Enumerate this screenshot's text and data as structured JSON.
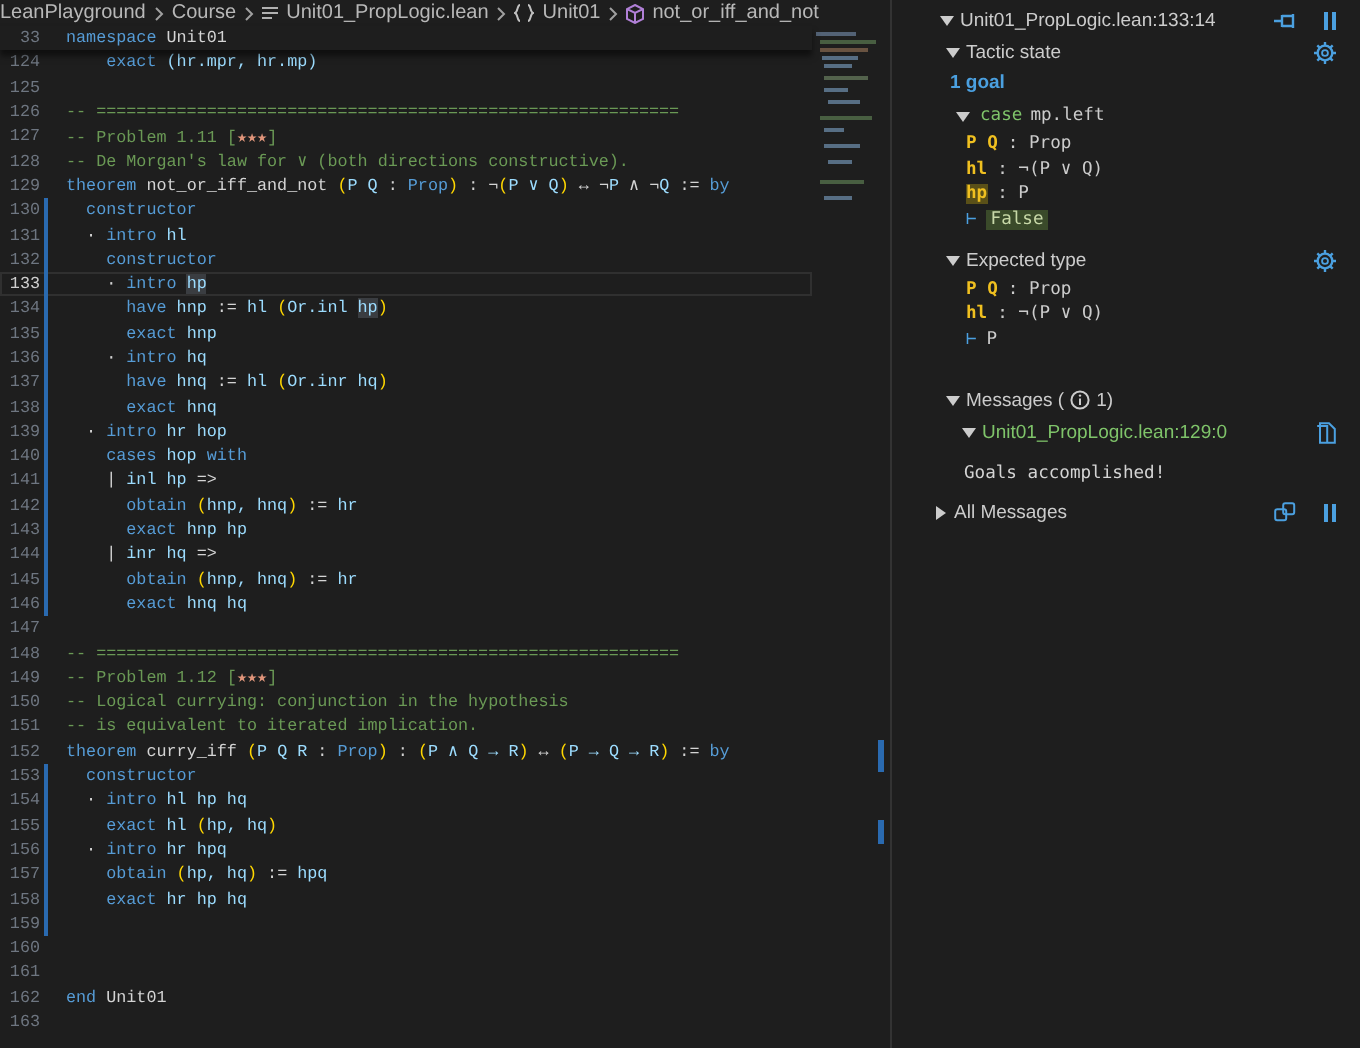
{
  "breadcrumbs": [
    {
      "text": "LeanPlayground",
      "kind": "folder"
    },
    {
      "text": "Course",
      "kind": "folder"
    },
    {
      "text": "Unit01_PropLogic.lean",
      "kind": "file"
    },
    {
      "text": "Unit01",
      "kind": "namespace"
    },
    {
      "text": "not_or_iff_and_not",
      "kind": "theorem"
    }
  ],
  "sticky_line": {
    "number": "33",
    "tokens": [
      {
        "text": "namespace",
        "kind": "keyword"
      },
      {
        "text": " Unit01",
        "kind": "plain"
      }
    ]
  },
  "lines": [
    {
      "number": "124",
      "current": false,
      "modified": false,
      "tokens": [
        {
          "text": "    exact ",
          "kind": "keyword"
        },
        {
          "text": "(hr.mpr, hr.mp)",
          "kind": "ident"
        }
      ]
    },
    {
      "number": "125",
      "current": false,
      "modified": false
    },
    {
      "number": "126",
      "current": false,
      "modified": false,
      "tokens": [
        {
          "text": "-- ==========================================================",
          "kind": "comment"
        }
      ]
    },
    {
      "number": "127",
      "current": false,
      "modified": false,
      "tokens": [
        {
          "text": "-- Problem 1.11 [",
          "kind": "comment"
        },
        {
          "text": "★★★",
          "kind": "stars"
        },
        {
          "text": "]",
          "kind": "comment"
        }
      ]
    },
    {
      "number": "128",
      "current": false,
      "modified": false,
      "tokens": [
        {
          "text": "-- De Morgan's law for ∨ (both directions constructive).",
          "kind": "comment"
        }
      ]
    },
    {
      "number": "129",
      "current": false,
      "modified": false,
      "tokens": [
        {
          "text": "theorem",
          "kind": "keyword"
        },
        {
          "text": " not_or_iff_and_not ",
          "kind": "plain"
        },
        {
          "text": "(",
          "kind": "bracket"
        },
        {
          "text": "P Q",
          "kind": "ident"
        },
        {
          "text": " : ",
          "kind": "plain"
        },
        {
          "text": "Prop",
          "kind": "keyword"
        },
        {
          "text": ")",
          "kind": "bracket"
        },
        {
          "text": " : ¬",
          "kind": "plain"
        },
        {
          "text": "(",
          "kind": "bracket"
        },
        {
          "text": "P ∨ Q",
          "kind": "ident"
        },
        {
          "text": ")",
          "kind": "bracket"
        },
        {
          "text": " ↔ ¬",
          "kind": "plain"
        },
        {
          "text": "P",
          "kind": "ident"
        },
        {
          "text": " ∧ ¬",
          "kind": "plain"
        },
        {
          "text": "Q",
          "kind": "ident"
        },
        {
          "text": " := ",
          "kind": "plain"
        },
        {
          "text": "by",
          "kind": "keyword"
        }
      ]
    },
    {
      "number": "130",
      "current": false,
      "modified": true,
      "tokens": [
        {
          "text": "  constructor",
          "kind": "keyword"
        }
      ]
    },
    {
      "number": "131",
      "current": false,
      "modified": true,
      "tokens": [
        {
          "text": "  · ",
          "kind": "plain"
        },
        {
          "text": "intro",
          "kind": "keyword"
        },
        {
          "text": " hl",
          "kind": "ident"
        }
      ]
    },
    {
      "number": "132",
      "current": false,
      "modified": true,
      "tokens": [
        {
          "text": "    constructor",
          "kind": "keyword"
        }
      ]
    },
    {
      "number": "133",
      "current": true,
      "modified": true,
      "tokens": [
        {
          "text": "    · ",
          "kind": "plain"
        },
        {
          "text": "intro ",
          "kind": "keyword"
        },
        {
          "text": "hp",
          "kind": "highlight"
        }
      ]
    },
    {
      "number": "134",
      "current": false,
      "modified": true,
      "tokens": [
        {
          "text": "      have",
          "kind": "keyword"
        },
        {
          "text": " hnp ",
          "kind": "ident"
        },
        {
          "text": ":= ",
          "kind": "plain"
        },
        {
          "text": "hl ",
          "kind": "ident"
        },
        {
          "text": "(",
          "kind": "bracket"
        },
        {
          "text": "Or.inl ",
          "kind": "ident"
        },
        {
          "text": "hp",
          "kind": "highlight"
        },
        {
          "text": ")",
          "kind": "bracket"
        }
      ]
    },
    {
      "number": "135",
      "current": false,
      "modified": true,
      "tokens": [
        {
          "text": "      exact",
          "kind": "keyword"
        },
        {
          "text": " hnp",
          "kind": "ident"
        }
      ]
    },
    {
      "number": "136",
      "current": false,
      "modified": true,
      "tokens": [
        {
          "text": "    · ",
          "kind": "plain"
        },
        {
          "text": "intro",
          "kind": "keyword"
        },
        {
          "text": " hq",
          "kind": "ident"
        }
      ]
    },
    {
      "number": "137",
      "current": false,
      "modified": true,
      "tokens": [
        {
          "text": "      have",
          "kind": "keyword"
        },
        {
          "text": " hnq ",
          "kind": "ident"
        },
        {
          "text": ":= ",
          "kind": "plain"
        },
        {
          "text": "hl ",
          "kind": "ident"
        },
        {
          "text": "(",
          "kind": "bracket"
        },
        {
          "text": "Or.inr hq",
          "kind": "ident"
        },
        {
          "text": ")",
          "kind": "bracket"
        }
      ]
    },
    {
      "number": "138",
      "current": false,
      "modified": true,
      "tokens": [
        {
          "text": "      exact",
          "kind": "keyword"
        },
        {
          "text": " hnq",
          "kind": "ident"
        }
      ]
    },
    {
      "number": "139",
      "current": false,
      "modified": true,
      "tokens": [
        {
          "text": "  · ",
          "kind": "plain"
        },
        {
          "text": "intro",
          "kind": "keyword"
        },
        {
          "text": " hr hop",
          "kind": "ident"
        }
      ]
    },
    {
      "number": "140",
      "current": false,
      "modified": true,
      "tokens": [
        {
          "text": "    cases",
          "kind": "keyword"
        },
        {
          "text": " hop ",
          "kind": "ident"
        },
        {
          "text": "with",
          "kind": "keyword"
        }
      ]
    },
    {
      "number": "141",
      "current": false,
      "modified": true,
      "tokens": [
        {
          "text": "    | ",
          "kind": "plain"
        },
        {
          "text": "inl hp",
          "kind": "ident"
        },
        {
          "text": " =>",
          "kind": "plain"
        }
      ]
    },
    {
      "number": "142",
      "current": false,
      "modified": true,
      "tokens": [
        {
          "text": "      obtain ",
          "kind": "keyword"
        },
        {
          "text": "(",
          "kind": "bracket"
        },
        {
          "text": "hnp, hnq",
          "kind": "ident"
        },
        {
          "text": ")",
          "kind": "bracket"
        },
        {
          "text": " := ",
          "kind": "plain"
        },
        {
          "text": "hr",
          "kind": "ident"
        }
      ]
    },
    {
      "number": "143",
      "current": false,
      "modified": true,
      "tokens": [
        {
          "text": "      exact",
          "kind": "keyword"
        },
        {
          "text": " hnp hp",
          "kind": "ident"
        }
      ]
    },
    {
      "number": "144",
      "current": false,
      "modified": true,
      "tokens": [
        {
          "text": "    | ",
          "kind": "plain"
        },
        {
          "text": "inr hq",
          "kind": "ident"
        },
        {
          "text": " =>",
          "kind": "plain"
        }
      ]
    },
    {
      "number": "145",
      "current": false,
      "modified": true,
      "tokens": [
        {
          "text": "      obtain ",
          "kind": "keyword"
        },
        {
          "text": "(",
          "kind": "bracket"
        },
        {
          "text": "hnp, hnq",
          "kind": "ident"
        },
        {
          "text": ")",
          "kind": "bracket"
        },
        {
          "text": " := ",
          "kind": "plain"
        },
        {
          "text": "hr",
          "kind": "ident"
        }
      ]
    },
    {
      "number": "146",
      "current": false,
      "modified": true,
      "tokens": [
        {
          "text": "      exact",
          "kind": "keyword"
        },
        {
          "text": " hnq hq",
          "kind": "ident"
        }
      ]
    },
    {
      "number": "147",
      "current": false,
      "modified": false
    },
    {
      "number": "148",
      "current": false,
      "modified": false,
      "tokens": [
        {
          "text": "-- ==========================================================",
          "kind": "comment"
        }
      ]
    },
    {
      "number": "149",
      "current": false,
      "modified": false,
      "tokens": [
        {
          "text": "-- Problem 1.12 [",
          "kind": "comment"
        },
        {
          "text": "★★★",
          "kind": "stars"
        },
        {
          "text": "]",
          "kind": "comment"
        }
      ]
    },
    {
      "number": "150",
      "current": false,
      "modified": false,
      "tokens": [
        {
          "text": "-- Logical currying: conjunction in the hypothesis",
          "kind": "comment"
        }
      ]
    },
    {
      "number": "151",
      "current": false,
      "modified": false,
      "tokens": [
        {
          "text": "-- is equivalent to iterated implication.",
          "kind": "comment"
        }
      ]
    },
    {
      "number": "152",
      "current": false,
      "modified": false,
      "tokens": [
        {
          "text": "theorem",
          "kind": "keyword"
        },
        {
          "text": " curry_iff ",
          "kind": "plain"
        },
        {
          "text": "(",
          "kind": "bracket"
        },
        {
          "text": "P Q R",
          "kind": "ident"
        },
        {
          "text": " : ",
          "kind": "plain"
        },
        {
          "text": "Prop",
          "kind": "keyword"
        },
        {
          "text": ")",
          "kind": "bracket"
        },
        {
          "text": " : ",
          "kind": "plain"
        },
        {
          "text": "(",
          "kind": "bracket"
        },
        {
          "text": "P ∧ Q → R",
          "kind": "ident"
        },
        {
          "text": ")",
          "kind": "bracket"
        },
        {
          "text": " ↔ ",
          "kind": "plain"
        },
        {
          "text": "(",
          "kind": "bracket"
        },
        {
          "text": "P → Q → R",
          "kind": "ident"
        },
        {
          "text": ")",
          "kind": "bracket"
        },
        {
          "text": " := ",
          "kind": "plain"
        },
        {
          "text": "by",
          "kind": "keyword"
        }
      ]
    },
    {
      "number": "153",
      "current": false,
      "modified": true,
      "tokens": [
        {
          "text": "  constructor",
          "kind": "keyword"
        }
      ]
    },
    {
      "number": "154",
      "current": false,
      "modified": true,
      "tokens": [
        {
          "text": "  · ",
          "kind": "plain"
        },
        {
          "text": "intro",
          "kind": "keyword"
        },
        {
          "text": " hl hp hq",
          "kind": "ident"
        }
      ]
    },
    {
      "number": "155",
      "current": false,
      "modified": true,
      "tokens": [
        {
          "text": "    exact",
          "kind": "keyword"
        },
        {
          "text": " hl ",
          "kind": "ident"
        },
        {
          "text": "(",
          "kind": "bracket"
        },
        {
          "text": "hp, hq",
          "kind": "ident"
        },
        {
          "text": ")",
          "kind": "bracket"
        }
      ]
    },
    {
      "number": "156",
      "current": false,
      "modified": true,
      "tokens": [
        {
          "text": "  · ",
          "kind": "plain"
        },
        {
          "text": "intro",
          "kind": "keyword"
        },
        {
          "text": " hr hpq",
          "kind": "ident"
        }
      ]
    },
    {
      "number": "157",
      "current": false,
      "modified": true,
      "tokens": [
        {
          "text": "    obtain ",
          "kind": "keyword"
        },
        {
          "text": "(",
          "kind": "bracket"
        },
        {
          "text": "hp, hq",
          "kind": "ident"
        },
        {
          "text": ")",
          "kind": "bracket"
        },
        {
          "text": " := ",
          "kind": "plain"
        },
        {
          "text": "hpq",
          "kind": "ident"
        }
      ]
    },
    {
      "number": "158",
      "current": false,
      "modified": true,
      "tokens": [
        {
          "text": "    exact",
          "kind": "keyword"
        },
        {
          "text": " hr hp hq",
          "kind": "ident"
        }
      ]
    },
    {
      "number": "159",
      "current": false,
      "modified": true
    },
    {
      "number": "160",
      "current": false,
      "modified": false
    },
    {
      "number": "161",
      "current": false,
      "modified": false
    },
    {
      "number": "162",
      "current": false,
      "modified": false,
      "tokens": [
        {
          "text": "end",
          "kind": "keyword"
        },
        {
          "text": " Unit01",
          "kind": "plain"
        }
      ]
    },
    {
      "number": "163",
      "current": false,
      "modified": false
    }
  ],
  "infoview": {
    "header": {
      "title": "Unit01_PropLogic.lean:133:14",
      "expanded": true
    },
    "tactic_state": {
      "title": "Tactic state",
      "expanded": true,
      "goal_count": "1 goal",
      "case_keyword": "case",
      "case_name": "mp.left",
      "hyps": [
        {
          "names": "P Q",
          "type": ": Prop",
          "highlighted": false
        },
        {
          "names": "hl",
          "type": ": ¬(P ∨ Q)",
          "highlighted": false
        },
        {
          "names": "hp",
          "type": ": P",
          "highlighted": true
        }
      ],
      "turnstile": "⊢",
      "goal": "False",
      "goal_highlighted": true
    },
    "expected_type": {
      "title": "Expected type",
      "expanded": true,
      "hyps": [
        {
          "names": "P Q",
          "type": ": Prop",
          "highlighted": false
        },
        {
          "names": "hl",
          "type": ": ¬(P ∨ Q)",
          "highlighted": false
        }
      ],
      "turnstile": "⊢",
      "goal": "P",
      "goal_highlighted": false
    },
    "messages": {
      "title": "Messages (",
      "count": "1)",
      "expanded": true,
      "items": [
        {
          "location": "Unit01_PropLogic.lean:129:0",
          "expanded": true,
          "text": "Goals accomplished!"
        }
      ]
    },
    "all_messages": {
      "title": "All Messages",
      "expanded": false
    }
  }
}
